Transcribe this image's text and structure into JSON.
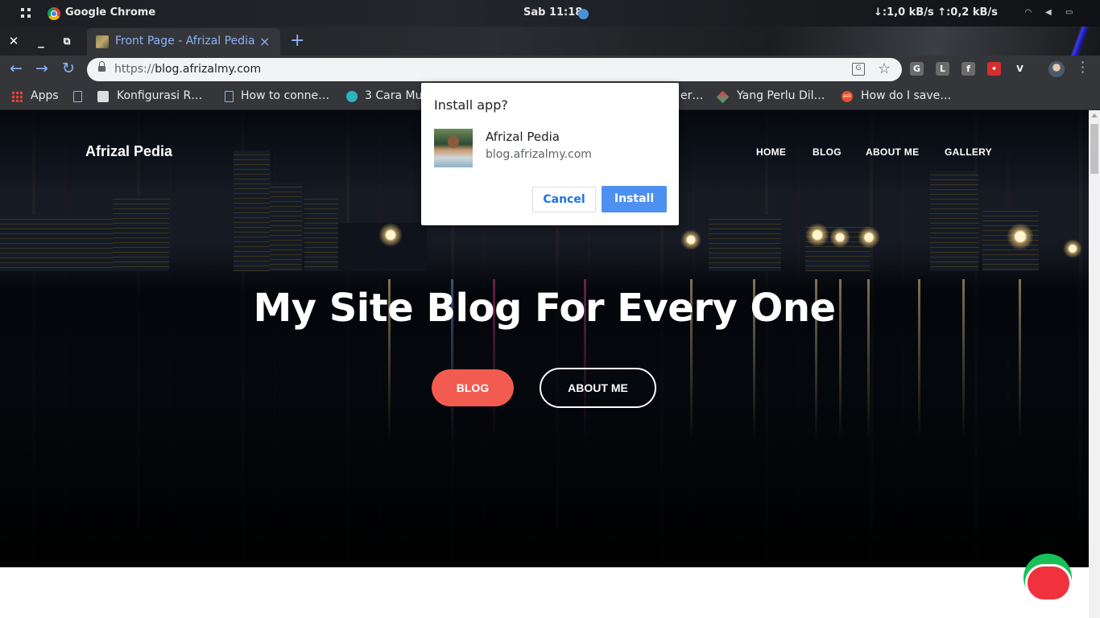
{
  "system_bar": {
    "app_name": "Google Chrome",
    "clock": "Sab 11:18",
    "net_speed": "↓:1,0 kB/s ↑:0,2 kB/s"
  },
  "tabs": [
    {
      "title": "Front Page - Afrizal Pedia",
      "active": true
    }
  ],
  "address_bar": {
    "scheme": "https://",
    "host": "blog.afrizalmy.com"
  },
  "bookmarks": [
    {
      "label": "Apps",
      "icon": "apps-grid-icon"
    },
    {
      "label": "",
      "icon": "document-icon"
    },
    {
      "label": "Konfigurasi R…",
      "icon": "site-favicon"
    },
    {
      "label": "How to conne…",
      "icon": "document-icon"
    },
    {
      "label": "3 Cara Mu",
      "icon": "site-favicon"
    },
    {
      "label": "er…",
      "icon": ""
    },
    {
      "label": "Yang Perlu Dil…",
      "icon": "site-favicon"
    },
    {
      "label": "How do I save…",
      "icon": "ask-icon"
    }
  ],
  "extensions": [
    {
      "name": "grammar-extension-icon",
      "glyph": "G",
      "color": "#6b6b6b"
    },
    {
      "name": "line-extension-icon",
      "glyph": "L",
      "color": "#6b6b6b"
    },
    {
      "name": "facebook-extension-icon",
      "glyph": "f",
      "color": "#6b6b6b"
    },
    {
      "name": "lastpass-extension-icon",
      "glyph": "•",
      "color": "#d32f2f"
    },
    {
      "name": "vimium-extension-icon",
      "glyph": "V",
      "color": "#35363a"
    }
  ],
  "site": {
    "title": "Afrizal Pedia",
    "nav": [
      "HOME",
      "BLOG",
      "ABOUT ME",
      "GALLERY"
    ],
    "hero_heading": "My Site Blog For Every One",
    "primary_button": "BLOG",
    "secondary_button": "ABOUT ME",
    "accent_color": "#f25b50"
  },
  "install_dialog": {
    "title": "Install app?",
    "app_name": "Afrizal Pedia",
    "origin": "blog.afrizalmy.com",
    "cancel_label": "Cancel",
    "install_label": "Install",
    "install_color": "#4d90f0"
  }
}
